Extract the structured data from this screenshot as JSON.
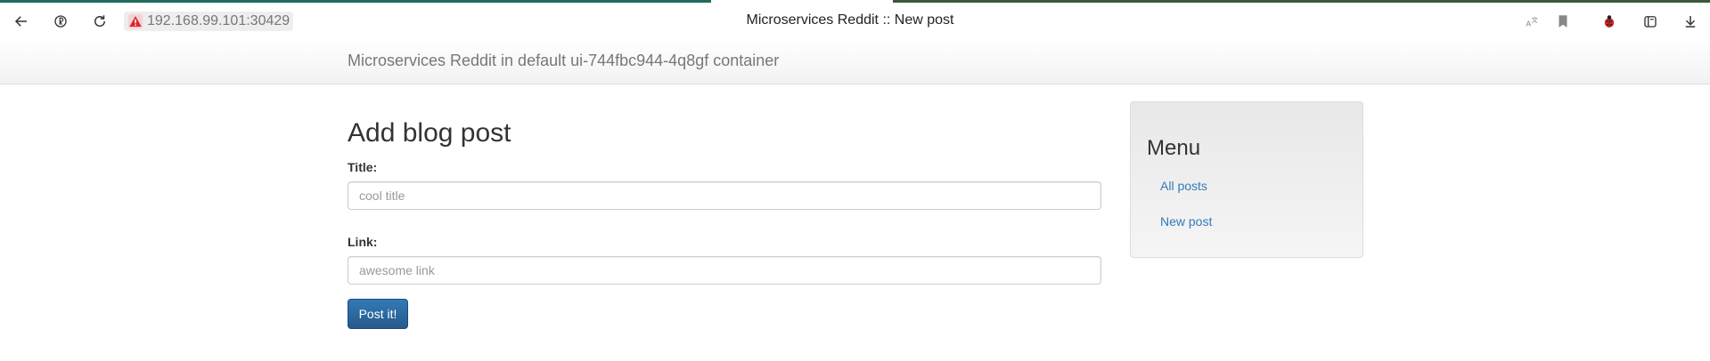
{
  "browser": {
    "url": "192.168.99.101:30429",
    "tab_title": "Microservices Reddit :: New post",
    "icons": {
      "back": "arrow-left-icon",
      "yandex": "yandex-icon",
      "reload": "reload-icon",
      "security": "warning-icon",
      "translate": "translate-icon",
      "bookmark": "bookmark-icon",
      "extension": "ladybug-icon",
      "collections": "collections-icon",
      "download": "download-icon"
    }
  },
  "navbar": {
    "brand": "Microservices Reddit in default ui-744fbc944-4q8gf container"
  },
  "form": {
    "heading": "Add blog post",
    "title_label": "Title:",
    "title_placeholder": "cool title",
    "link_label": "Link:",
    "link_placeholder": "awesome link",
    "submit_label": "Post it!"
  },
  "sidebar": {
    "heading": "Menu",
    "items": [
      {
        "label": "All posts"
      },
      {
        "label": "New post"
      }
    ]
  },
  "colors": {
    "link": "#337ab7",
    "primary_button": "#265a88",
    "security_warning": "#e0262d"
  }
}
